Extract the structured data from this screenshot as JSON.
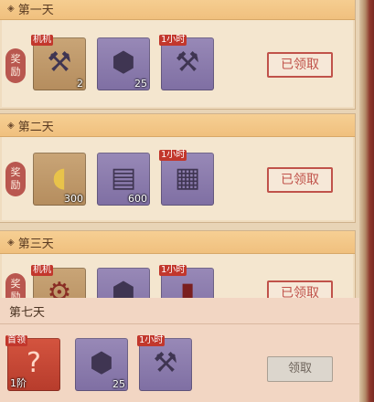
{
  "days": [
    {
      "title": "第一天",
      "label": [
        "奖",
        "励"
      ],
      "button": "已领取",
      "items": [
        {
          "tag": "机机",
          "qty": "2",
          "color": "brown",
          "icon": "hammer-bench-icon"
        },
        {
          "tag": "",
          "qty": "25",
          "color": "purple",
          "icon": "ore-icon"
        },
        {
          "tag": "1小时",
          "qty": "",
          "color": "purple",
          "icon": "speedup-hammer-icon"
        }
      ]
    },
    {
      "title": "第二天",
      "label": [
        "奖",
        "励"
      ],
      "button": "已领取",
      "items": [
        {
          "tag": "",
          "qty": "300",
          "color": "brown",
          "icon": "gold-ingot-icon"
        },
        {
          "tag": "",
          "qty": "600",
          "color": "purple",
          "icon": "scroll-bundle-icon"
        },
        {
          "tag": "1小时",
          "qty": "",
          "color": "purple",
          "icon": "speedup-scroll-icon"
        }
      ]
    },
    {
      "title": "第三天",
      "label": [
        "奖",
        "励"
      ],
      "button": "已领取",
      "items": [
        {
          "tag": "机机",
          "qty": "",
          "color": "brown",
          "icon": "mechanism-icon"
        },
        {
          "tag": "",
          "qty": "",
          "color": "purple",
          "icon": "ore-icon"
        },
        {
          "tag": "1小时",
          "qty": "",
          "color": "purple",
          "icon": "speedup-icon"
        }
      ]
    }
  ],
  "final": {
    "title": "第七天",
    "button": "领取",
    "items": [
      {
        "tag": "首领",
        "qty": "1阶",
        "color": "red",
        "icon": "mystery-gem-icon"
      },
      {
        "tag": "",
        "qty": "25",
        "color": "purple",
        "icon": "ore-icon"
      },
      {
        "tag": "1小时",
        "qty": "",
        "color": "purple",
        "icon": "speedup-hammer-icon"
      }
    ]
  }
}
